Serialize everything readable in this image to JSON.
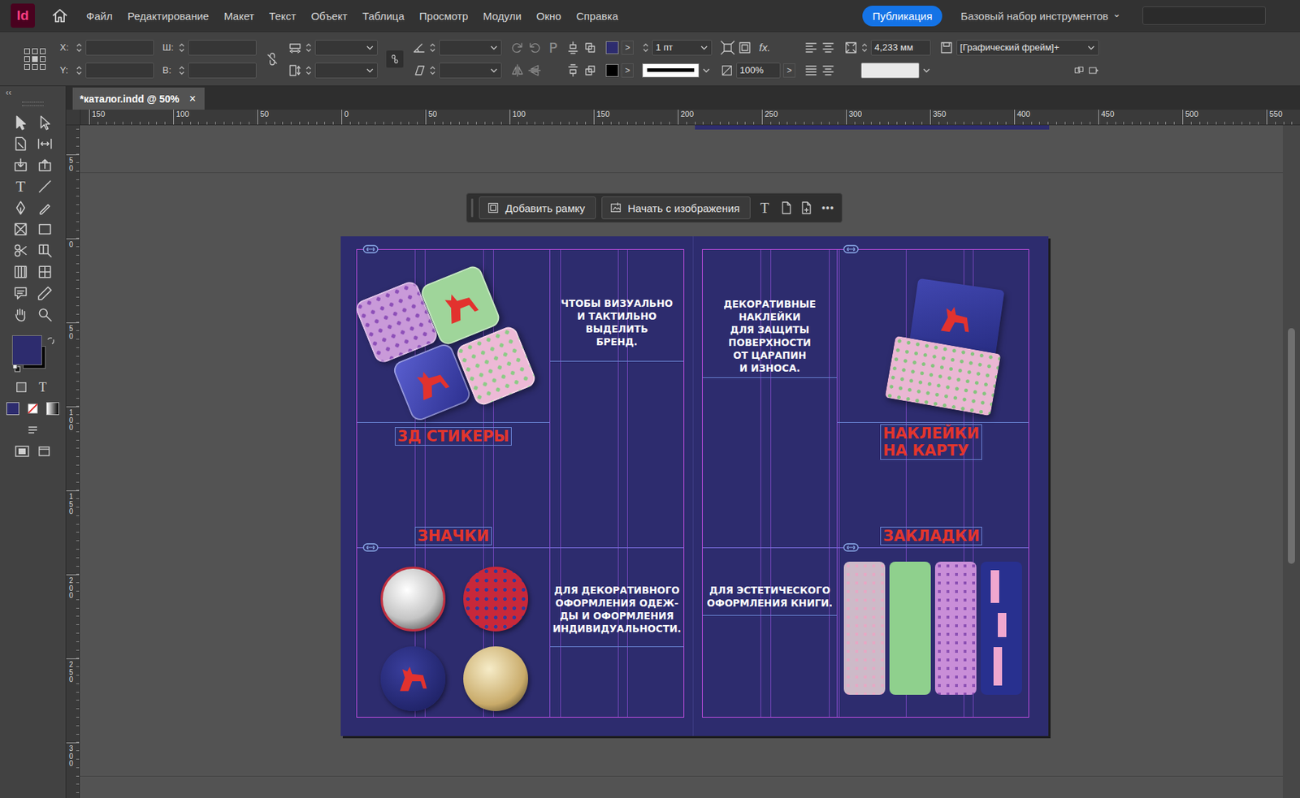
{
  "app": {
    "logo": "Id"
  },
  "menu": [
    "Файл",
    "Редактирование",
    "Макет",
    "Текст",
    "Объект",
    "Таблица",
    "Просмотр",
    "Модули",
    "Окно",
    "Справка"
  ],
  "publish_button": "Публикация",
  "workspace": {
    "label": "Базовый набор инструментов",
    "chevron": "⌄"
  },
  "control_panel": {
    "x_label": "X:",
    "y_label": "Y:",
    "w_label": "Ш:",
    "h_label": "В:",
    "paragraph_glyph": "P",
    "arrow_glyph": ">",
    "stroke_weight": "1 пт",
    "effects_label": "fx.",
    "opacity": "100%",
    "fitting_offset": "4,233 мм",
    "object_style": "[Графический фрейм]+"
  },
  "toolbar": {
    "collapse_glyph": "‹‹",
    "type_glyph": "T",
    "text_mode_glyph": "T"
  },
  "document_tab": {
    "title": "*каталог.indd @ 50%",
    "close": "×",
    "selected": true
  },
  "rulers": {
    "horizontal": [
      "150",
      "100",
      "50",
      "0",
      "50",
      "100",
      "150",
      "200",
      "250",
      "300",
      "350",
      "400",
      "450",
      "500",
      "550"
    ],
    "vertical": [
      "50",
      "0",
      "50",
      "100",
      "150",
      "200",
      "250",
      "300"
    ]
  },
  "context_bar": {
    "buttons": [
      "Добавить рамку",
      "Начать с изображения"
    ],
    "type_glyph": "T",
    "more": "•••"
  },
  "spread": {
    "stickers": {
      "title": [
        "3Д СТИКЕРЫ"
      ],
      "text": [
        "ЧТОБЫ ВИЗУАЛЬНО",
        "И ТАКТИЛЬНО",
        "ВЫДЕЛИТЬ",
        "БРЕНД."
      ]
    },
    "badges": {
      "title": [
        "ЗНАЧКИ"
      ],
      "text": [
        "ДЛЯ ДЕКОРАТИВНОГО",
        "ОФОРМЛЕНИЯ ОДЕЖ-",
        "ДЫ И ОФОРМЛЕНИЯ",
        "ИНДИВИДУАЛЬНОСТИ."
      ]
    },
    "card_stickers": {
      "title": [
        "НАКЛЕЙКИ",
        "НА КАРТУ"
      ],
      "text": [
        "ДЕКОРАТИВНЫЕ",
        "НАКЛЕЙКИ",
        "ДЛЯ ЗАЩИТЫ",
        "ПОВЕРХНОСТИ",
        "ОТ ЦАРАПИН",
        "И ИЗНОСА."
      ]
    },
    "bookmarks": {
      "title": [
        "ЗАКЛАДКИ"
      ],
      "text": [
        "ДЛЯ ЭСТЕТИЧЕСКОГО",
        "ОФОРМЛЕНИЯ КНИГИ."
      ]
    }
  }
}
